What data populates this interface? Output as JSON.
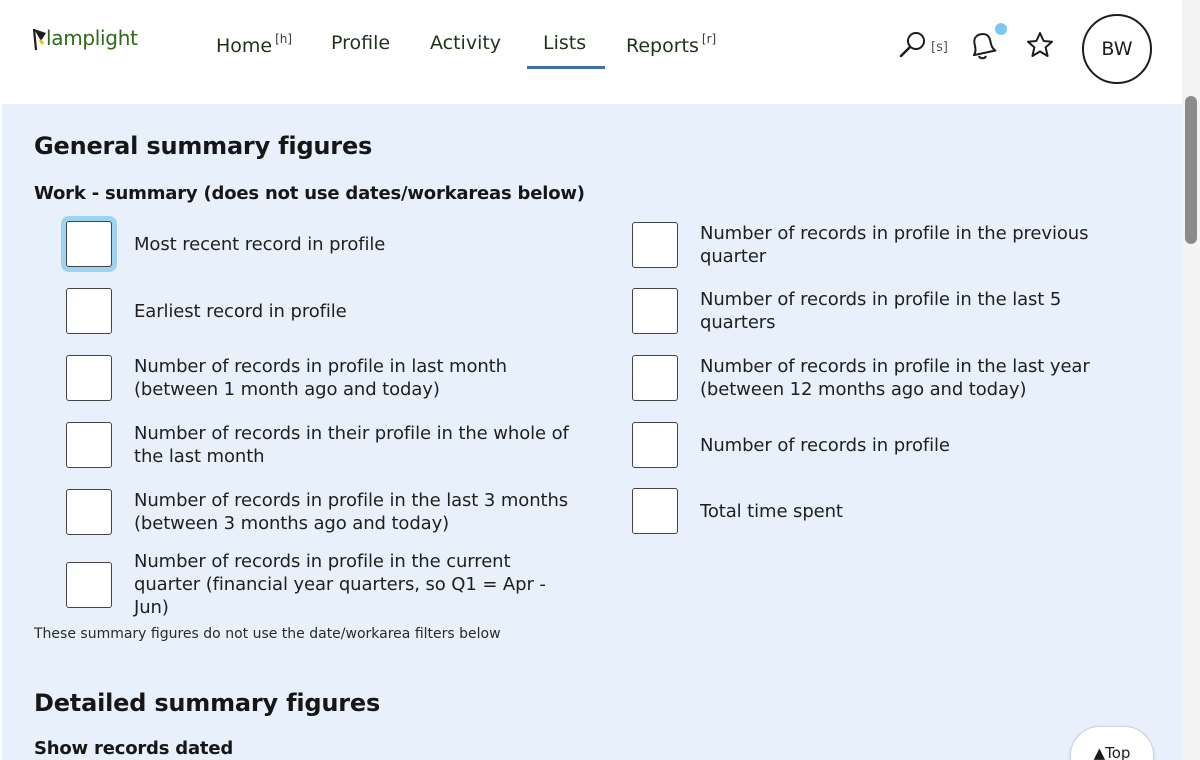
{
  "header": {
    "logo_text": "lamplight",
    "nav": [
      {
        "label": "Home",
        "hint": "[h]"
      },
      {
        "label": "Profile",
        "hint": ""
      },
      {
        "label": "Activity",
        "hint": ""
      },
      {
        "label": "Lists",
        "hint": ""
      },
      {
        "label": "Reports",
        "hint": "[r]"
      }
    ],
    "active_nav": "Lists",
    "search_hint": "[s]",
    "avatar_initials": "BW"
  },
  "section_general": {
    "title": "General summary figures",
    "subtitle": "Work - summary (does not use dates/workareas below)",
    "options_left": [
      {
        "label": "Most recent record in profile",
        "checked": false
      },
      {
        "label": "Earliest record in profile",
        "checked": false
      },
      {
        "label": "Number of records in profile in last month (between 1 month ago and today)",
        "checked": false
      },
      {
        "label": "Number of records in their profile in the whole of the last month",
        "checked": false
      },
      {
        "label": "Number of records in profile in the last 3 months (between 3 months ago and today)",
        "checked": false
      },
      {
        "label": "Number of records in profile in the current quarter (financial year quarters, so Q1 = Apr - Jun)",
        "checked": false
      }
    ],
    "options_right": [
      {
        "label": "Number of records in profile in the previous quarter",
        "checked": false
      },
      {
        "label": "Number of records in profile in the last 5 quarters",
        "checked": false
      },
      {
        "label": "Number of records in profile in the last year (between 12 months ago and today)",
        "checked": false
      },
      {
        "label": "Number of records in profile",
        "checked": false
      },
      {
        "label": "Total time spent",
        "checked": false
      }
    ],
    "note": "These summary figures do not use the date/workarea filters below"
  },
  "section_detailed": {
    "title": "Detailed summary figures",
    "subtitle": "Show records dated"
  },
  "top_button_label": "▲Top"
}
